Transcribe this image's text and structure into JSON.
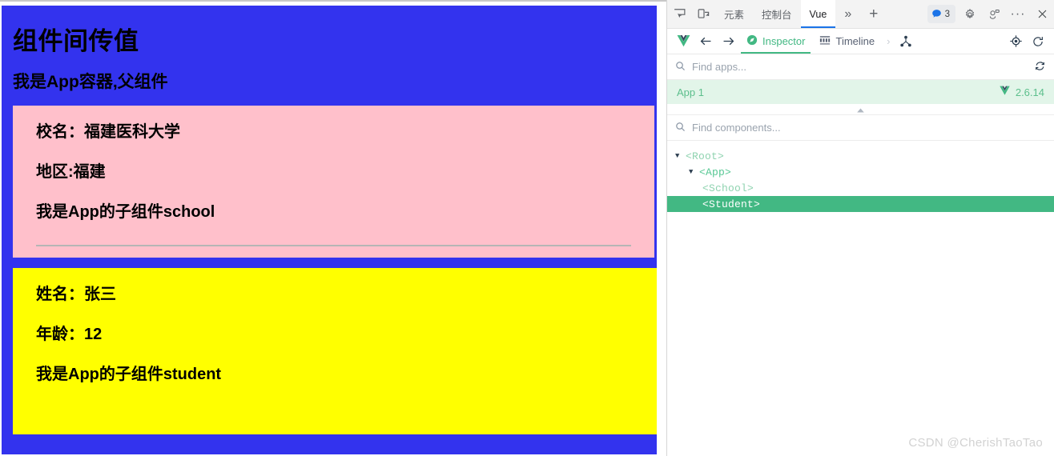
{
  "page": {
    "title": "组件间传值",
    "subtitle": "我是App容器,父组件",
    "school": {
      "lines": [
        "校名：福建医科大学",
        "地区:福建",
        "我是App的子组件school"
      ],
      "bg_color": "#ffc0cb"
    },
    "student": {
      "lines": [
        "姓名：张三",
        "年龄：12",
        "我是App的子组件student"
      ],
      "bg_color": "#ffff00"
    },
    "bg_color": "#3333ee"
  },
  "devtools": {
    "tabstrip": {
      "inspect_icon": "inspect-element-icon",
      "device_icon": "device-toolbar-icon",
      "tabs": [
        {
          "label": "元素",
          "active": false
        },
        {
          "label": "控制台",
          "active": false
        },
        {
          "label": "Vue",
          "active": true
        }
      ],
      "overflow_label": "»",
      "add_label": "+",
      "message_badge": "3",
      "gear_icon": "settings-gear-icon",
      "feedback_icon": "feedback-icon",
      "more_icon": "more-options-icon",
      "close_icon": "close-icon"
    },
    "vue_toolbar": {
      "logo_icon": "vue-logo-icon",
      "back_icon": "back-arrow-icon",
      "forward_icon": "forward-arrow-icon",
      "tabs": [
        {
          "label": "Inspector",
          "icon": "compass-icon",
          "active": true
        },
        {
          "label": "Timeline",
          "icon": "timeline-icon",
          "active": false
        }
      ],
      "chevron_label": "›",
      "hierarchy_icon": "component-hierarchy-icon",
      "target_icon": "select-component-icon",
      "refresh_icon": "refresh-icon",
      "accent_color": "#42b883"
    },
    "find_apps": {
      "placeholder": "Find apps...",
      "value": "",
      "search_icon": "search-icon",
      "refresh_icon": "refresh-apps-icon"
    },
    "app_row": {
      "name": "App 1",
      "version": "2.6.14",
      "logo_icon": "vue-logo-icon"
    },
    "collapse_icon": "collapse-chevron-icon",
    "find_components": {
      "placeholder": "Find components...",
      "value": "",
      "search_icon": "search-icon"
    },
    "tree": [
      {
        "label": "<Root>",
        "depth": 0,
        "expanded": true,
        "selected": false,
        "style": "muted"
      },
      {
        "label": "<App>",
        "depth": 1,
        "expanded": true,
        "selected": false,
        "style": "bright"
      },
      {
        "label": "<School>",
        "depth": 2,
        "expanded": null,
        "selected": false,
        "style": "muted"
      },
      {
        "label": "<Student>",
        "depth": 2,
        "expanded": null,
        "selected": true,
        "style": "bright"
      }
    ]
  },
  "watermark": "CSDN @CherishTaoTao"
}
